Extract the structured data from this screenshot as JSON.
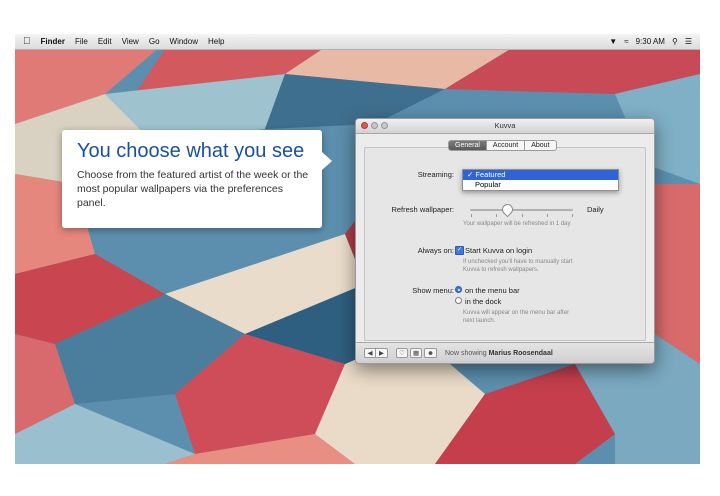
{
  "menubar": {
    "apple": "",
    "items": [
      "Finder",
      "File",
      "Edit",
      "View",
      "Go",
      "Window",
      "Help"
    ],
    "clock": "9:30 AM",
    "icons": [
      "kuvva-icon",
      "wifi-icon",
      "search-icon",
      "list-icon"
    ]
  },
  "callout": {
    "title": "You choose what you see",
    "body": "Choose from the featured artist of the week or the most popular wallpapers via the preferences panel."
  },
  "window": {
    "title": "Kuvva",
    "tabs": [
      "General",
      "Account",
      "About"
    ],
    "active_tab": "General",
    "streaming": {
      "label": "Streaming:",
      "options": [
        "Featured",
        "Popular"
      ],
      "selected": "Featured",
      "selected_mark": "✓"
    },
    "refresh": {
      "label": "Refresh wallpaper:",
      "value_label": "Daily",
      "hint": "Your wallpaper will be refreshed in 1 day"
    },
    "always_on": {
      "label": "Always on:",
      "checkbox_label": "Start Kuvva on login",
      "checked": true,
      "hint": "If unchecked you'll have to manually start Kuvva to refresh wallpapers."
    },
    "show_menu": {
      "label": "Show menu:",
      "options": [
        "on the menu bar",
        "in the dock"
      ],
      "selected": "on the menu bar",
      "hint": "Kuvva will appear on the menu bar after next launch."
    },
    "bottom": {
      "prev": "◀",
      "next": "▶",
      "now_showing_prefix": "Now showing",
      "artist": "Marius Roosendaal"
    }
  }
}
